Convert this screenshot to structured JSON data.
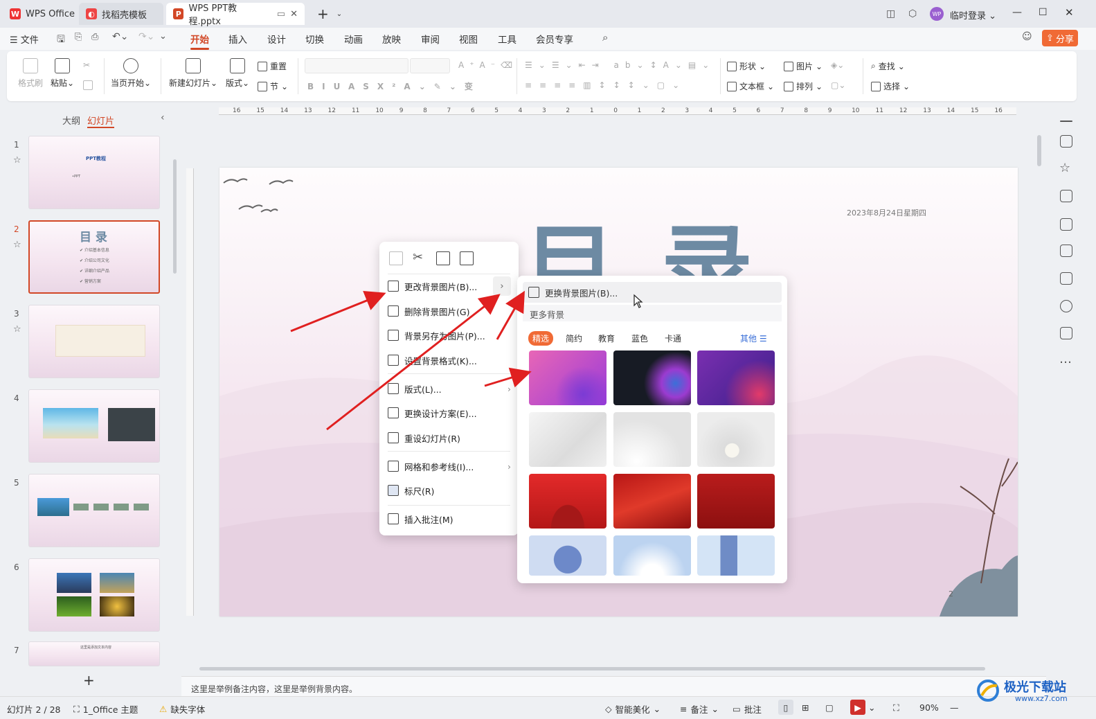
{
  "tabs": {
    "wps_office": "WPS Office",
    "template": "找稻壳模板",
    "doc": "WPS PPT教程.pptx",
    "new": "+"
  },
  "account": {
    "avatar": "WP",
    "login": "临时登录"
  },
  "menu": {
    "file": "文件",
    "items": [
      "开始",
      "插入",
      "设计",
      "切换",
      "动画",
      "放映",
      "审阅",
      "视图",
      "工具",
      "会员专享"
    ],
    "active": "开始",
    "share": "分享"
  },
  "ribbon": {
    "format_painter": "格式刷",
    "paste": "粘贴",
    "from_current": "当页开始",
    "new_slide": "新建幻灯片",
    "layout": "版式",
    "reset": "重置",
    "section": "节",
    "shape": "形状",
    "picture": "图片",
    "textbox": "文本框",
    "arrange": "排列",
    "find": "查找",
    "select": "选择"
  },
  "outline": {
    "outline_tab": "大纲",
    "slides_tab": "幻灯片"
  },
  "thumbnails": [
    "1",
    "2",
    "3",
    "4",
    "5",
    "6",
    "7"
  ],
  "thumb_text": {
    "s1_title": "PPT教程",
    "s1_sub": "•PPT",
    "s2_title": "目 录",
    "s2_items": [
      "✔ 介绍基本信息",
      "✔ 介绍公司文化",
      "✔ 详细介绍产品",
      "✔ 营销方案"
    ],
    "s7_title": "这里是添加文本内容"
  },
  "ruler_marks": [
    "16",
    "15",
    "14",
    "13",
    "12",
    "11",
    "10",
    "9",
    "8",
    "7",
    "6",
    "5",
    "4",
    "3",
    "2",
    "1",
    "0",
    "1",
    "2",
    "3",
    "4",
    "5",
    "6",
    "7",
    "8",
    "9",
    "10",
    "11",
    "12",
    "13",
    "14",
    "15",
    "16"
  ],
  "slide": {
    "title": "目 录",
    "date": "2023年8月24日星期四",
    "page_no": "2"
  },
  "context_menu": {
    "change_bg": "更改背景图片(B)...",
    "delete_bg": "删除背景图片(G)",
    "save_bg": "背景另存为图片(P)...",
    "bg_format": "设置背景格式(K)...",
    "layout": "版式(L)...",
    "change_design": "更换设计方案(E)...",
    "reset_slide": "重设幻灯片(R)",
    "grid": "网格和参考线(I)...",
    "ruler": "标尺(R)",
    "comment": "插入批注(M)"
  },
  "submenu": {
    "replace_bg": "更换背景图片(B)...",
    "more_bg": "更多背景",
    "filters": [
      "精选",
      "简约",
      "教育",
      "蓝色",
      "卡通"
    ],
    "active_filter": "精选",
    "other": "其他 ☰"
  },
  "notes": "这里是举例备注内容，这里是举例背景内容。",
  "status": {
    "slide_count": "幻灯片 2 / 28",
    "theme": "1_Office 主题",
    "missing_font": "缺失字体",
    "beautify": "智能美化",
    "notes_btn": "备注",
    "comments_btn": "批注",
    "zoom": "90%"
  },
  "watermark": {
    "text": "极光下载站",
    "url": "www.xz7.com"
  },
  "colors": {
    "accent": "#d24726",
    "title_text": "#6d8aa3"
  }
}
